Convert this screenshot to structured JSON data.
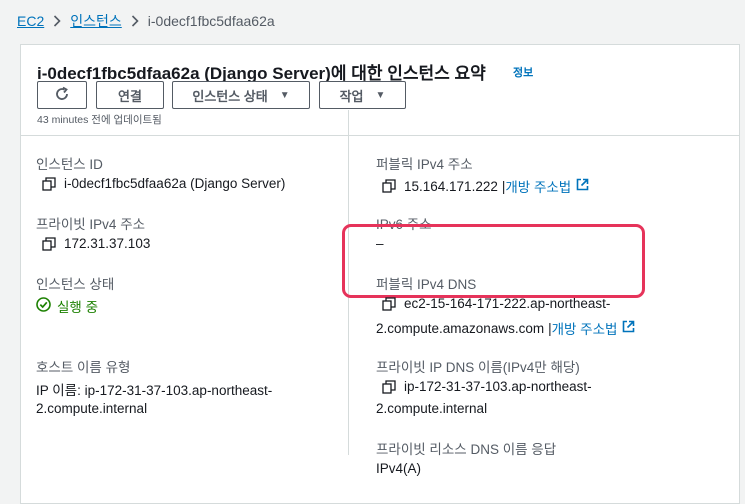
{
  "breadcrumb": {
    "items": [
      "EC2",
      "인스턴스"
    ],
    "current": "i-0decf1fbc5dfaa62a"
  },
  "header": {
    "title": "i-0decf1fbc5dfaa62a (Django Server)에 대한 인스턴스 요약",
    "info_link": "정보",
    "buttons": {
      "connect": "연결",
      "instance_state": "인스턴스 상태",
      "actions": "작업"
    },
    "updated": "43 minutes 전에 업데이트됨"
  },
  "fields": {
    "instance_id": {
      "label": "인스턴스 ID",
      "value": "i-0decf1fbc5dfaa62a (Django Server)"
    },
    "public_ipv4": {
      "label": "퍼블릭 IPv4 주소",
      "value": "15.164.171.222",
      "link": "개방 주소법"
    },
    "private_ipv4": {
      "label": "프라이빗 IPv4 주소",
      "value": "172.31.37.103"
    },
    "ipv6": {
      "label": "IPv6 주소",
      "value": "–"
    },
    "instance_state": {
      "label": "인스턴스 상태",
      "value": "실행 중"
    },
    "public_dns": {
      "label": "퍼블릭 IPv4 DNS",
      "value_line1": "ec2-15-164-171-222.ap-northeast-",
      "value_line2": "2.compute.amazonaws.com",
      "link": "개방 주소법"
    },
    "hostname_type": {
      "label": "호스트 이름 유형",
      "value_line1": "IP 이름: ip-172-31-37-103.ap-northeast-",
      "value_line2": "2.compute.internal"
    },
    "private_dns": {
      "label": "프라이빗 IP DNS 이름(IPv4만 해당)",
      "value_line1": "ip-172-31-37-103.ap-northeast-",
      "value_line2": "2.compute.internal"
    },
    "private_resource_dns": {
      "label": "프라이빗 리소스 DNS 이름 응답",
      "value": "IPv4(A)"
    }
  },
  "colors": {
    "link": "#0073bb",
    "running": "#1d8102",
    "highlight": "#e6335a",
    "text": "#16191f",
    "muted": "#545b64"
  }
}
